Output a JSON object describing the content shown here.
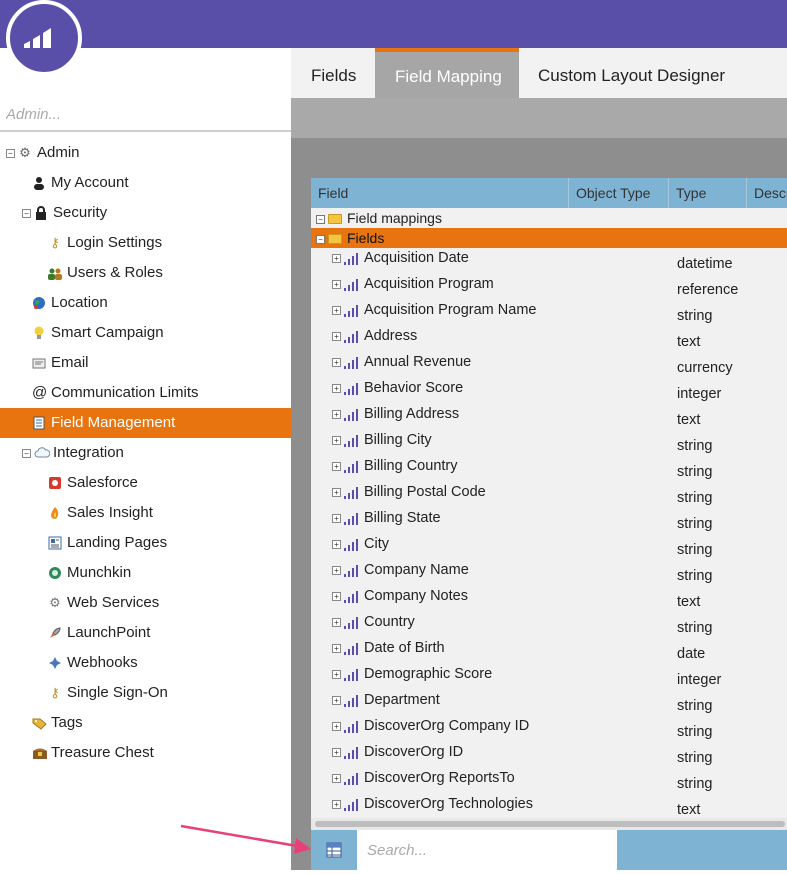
{
  "search": {
    "admin_placeholder": "Admin...",
    "grid_placeholder": "Search..."
  },
  "tabs": [
    {
      "label": "Fields",
      "active": false
    },
    {
      "label": "Field Mapping",
      "active": true
    },
    {
      "label": "Custom Layout Designer",
      "active": false
    }
  ],
  "tree": {
    "admin": "Admin",
    "my_account": "My Account",
    "security": "Security",
    "login_settings": "Login Settings",
    "users_roles": "Users & Roles",
    "location": "Location",
    "smart_campaign": "Smart Campaign",
    "email": "Email",
    "communication_limits": "Communication Limits",
    "field_management": "Field Management",
    "integration": "Integration",
    "salesforce": "Salesforce",
    "sales_insight": "Sales Insight",
    "landing_pages": "Landing Pages",
    "munchkin": "Munchkin",
    "web_services": "Web Services",
    "launchpoint": "LaunchPoint",
    "webhooks": "Webhooks",
    "single_sign_on": "Single Sign-On",
    "tags": "Tags",
    "treasure_chest": "Treasure Chest"
  },
  "grid": {
    "columns": [
      "Field",
      "Object Type",
      "Type",
      "Descr"
    ],
    "groups": {
      "field_mappings": "Field mappings",
      "fields": "Fields"
    },
    "rows": [
      {
        "name": "Acquisition Date",
        "type": "datetime"
      },
      {
        "name": "Acquisition Program",
        "type": "reference"
      },
      {
        "name": "Acquisition Program Name",
        "type": "string"
      },
      {
        "name": "Address",
        "type": "text"
      },
      {
        "name": "Annual Revenue",
        "type": "currency"
      },
      {
        "name": "Behavior Score",
        "type": "integer"
      },
      {
        "name": "Billing Address",
        "type": "text"
      },
      {
        "name": "Billing City",
        "type": "string"
      },
      {
        "name": "Billing Country",
        "type": "string"
      },
      {
        "name": "Billing Postal Code",
        "type": "string"
      },
      {
        "name": "Billing State",
        "type": "string"
      },
      {
        "name": "City",
        "type": "string"
      },
      {
        "name": "Company Name",
        "type": "string"
      },
      {
        "name": "Company Notes",
        "type": "text"
      },
      {
        "name": "Country",
        "type": "string"
      },
      {
        "name": "Date of Birth",
        "type": "date"
      },
      {
        "name": "Demographic Score",
        "type": "integer"
      },
      {
        "name": "Department",
        "type": "string"
      },
      {
        "name": "DiscoverOrg Company ID",
        "type": "string"
      },
      {
        "name": "DiscoverOrg ID",
        "type": "string"
      },
      {
        "name": "DiscoverOrg ReportsTo",
        "type": "string"
      },
      {
        "name": "DiscoverOrg Technologies",
        "type": "text"
      }
    ]
  },
  "colors": {
    "brand": "#5a4fa8",
    "accent": "#e8740f",
    "grid_header": "#7fb3d3",
    "annotation_arrow": "#e8407a"
  }
}
